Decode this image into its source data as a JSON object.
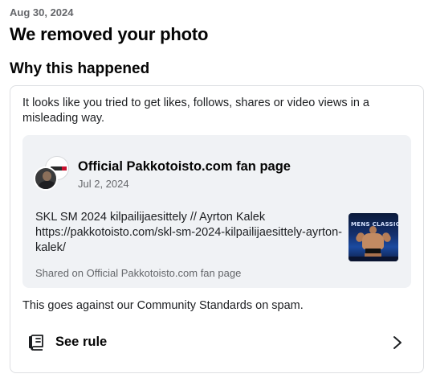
{
  "header": {
    "date": "Aug 30, 2024",
    "title": "We removed your photo"
  },
  "section": {
    "title": "Why this happened",
    "reason": "It looks like you tried to get likes, follows, shares or video views in a misleading way."
  },
  "post": {
    "page_name": "Official Pakkotoisto.com fan page",
    "date": "Jul 2, 2024",
    "text": "SKL SM 2024 kilpailijaesittely // Ayrton Kalek https://pakkotoisto.com/skl-sm-2024-kilpailijaesittely-ayrton-kalek/",
    "thumbnail_text": "MENS CLASSIC",
    "shared_on": "Shared on Official Pakkotoisto.com fan page",
    "avatar_icon": "page-avatar-icon",
    "thumbnail_icon": "post-thumbnail-image"
  },
  "standards": {
    "text": "This goes against our Community Standards on spam."
  },
  "rule": {
    "label": "See rule",
    "icon": "book-icon",
    "chevron": "chevron-right-icon"
  },
  "colors": {
    "text_primary": "#050505",
    "text_secondary": "#65676b",
    "card_background": "#f0f2f5",
    "border": "#dddfe2"
  }
}
